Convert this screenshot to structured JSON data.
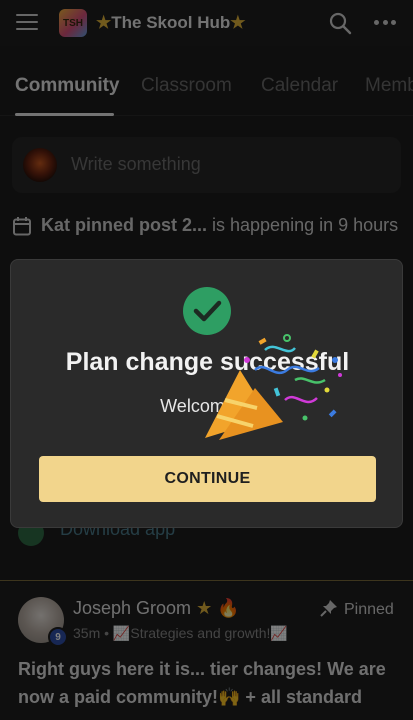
{
  "header": {
    "logo_text": "TSH",
    "title": "The Skool Hub",
    "star": "★"
  },
  "tabs": [
    {
      "label": "Community",
      "active": true
    },
    {
      "label": "Classroom",
      "active": false
    },
    {
      "label": "Calendar",
      "active": false
    },
    {
      "label": "Memb",
      "active": false
    }
  ],
  "compose": {
    "placeholder": "Write something"
  },
  "event": {
    "pinned_text": "Kat pinned post 2...",
    "status": "is happening in 9 hours"
  },
  "background_link": "Download app",
  "modal": {
    "title": "Plan change successful",
    "subtitle": "Welcome to",
    "button": "CONTINUE"
  },
  "post": {
    "author": "Joseph Groom",
    "author_badges": "★ 🔥",
    "level": "9",
    "time": "35m",
    "category": "📈Strategies and growth!📈",
    "pinned_label": "Pinned",
    "body": "Right guys here it is... tier changes! We are now a paid community!🙌 + all standard"
  },
  "colors": {
    "accent_button": "#f2d58c",
    "success": "#2e9e63",
    "star": "#e3b53a",
    "background": "#1c1c1c"
  }
}
